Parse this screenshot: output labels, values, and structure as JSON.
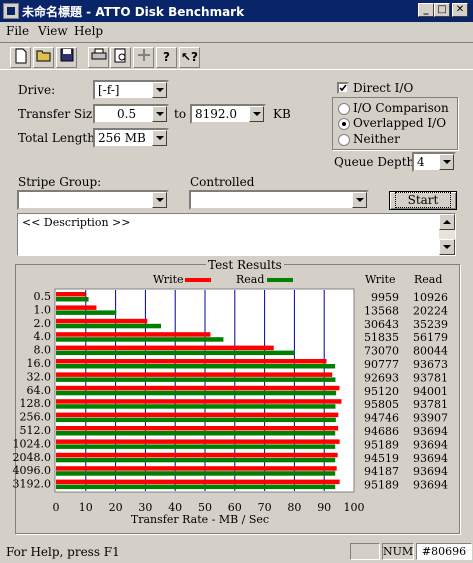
{
  "window": {
    "title": "未命名標題 - ATTO Disk Benchmark"
  },
  "menu": [
    "File",
    "View",
    "Help"
  ],
  "toolbar_icons": [
    "new-document-icon",
    "open-folder-icon",
    "save-icon",
    "print-icon",
    "print-preview-icon",
    "move-icon",
    "help-icon",
    "context-help-icon"
  ],
  "form": {
    "drive_label": "Drive:",
    "drive_value": "[-f-]",
    "transfer_size_label": "Transfer Size:",
    "transfer_from": "0.5",
    "to_label": "to",
    "transfer_to": "8192.0",
    "kb_label": "KB",
    "total_length_label": "Total Length:",
    "total_length_value": "256 MB",
    "direct_io_label": "Direct I/O",
    "direct_io_checked": true,
    "io_comparison_label": "I/O Comparison",
    "overlapped_io_label": "Overlapped I/O",
    "neither_label": "Neither",
    "selected_mode": "Overlapped I/O",
    "queue_depth_label": "Queue Depth:",
    "queue_depth_value": "4",
    "stripe_group_label": "Stripe Group:",
    "stripe_group_value": "",
    "controlled_label": "Controlled",
    "controlled_value": "",
    "start_label": "Start",
    "description": "<< Description >>"
  },
  "results": {
    "title": "Test Results",
    "write_legend": "Write",
    "read_legend": "Read",
    "write_header": "Write",
    "read_header": "Read",
    "write_color": "#ff0000",
    "read_color": "#008000"
  },
  "chart_data": {
    "type": "bar",
    "orientation": "horizontal",
    "categories": [
      "0.5",
      "1.0",
      "2.0",
      "4.0",
      "8.0",
      "16.0",
      "32.0",
      "64.0",
      "128.0",
      "256.0",
      "512.0",
      "1024.0",
      "2048.0",
      "4096.0",
      "3192.0"
    ],
    "series": [
      {
        "name": "Write",
        "values": [
          9959,
          13568,
          30643,
          51835,
          73070,
          90777,
          92693,
          95120,
          95805,
          94746,
          94686,
          95189,
          94519,
          94187,
          95189
        ]
      },
      {
        "name": "Read",
        "values": [
          10926,
          20224,
          35239,
          56179,
          80044,
          93673,
          93781,
          94001,
          93781,
          93907,
          93694,
          93694,
          93694,
          93694,
          93694
        ]
      }
    ],
    "xlabel": "Transfer Rate - MB / Sec",
    "xticks": [
      "0",
      "10",
      "20",
      "30",
      "40",
      "50",
      "60",
      "70",
      "80",
      "90",
      "100"
    ],
    "xlim": [
      0,
      100
    ],
    "grid": true
  },
  "status": {
    "help_text": "For Help, press F1",
    "num_label": "NUM",
    "watermark": "#80696"
  }
}
